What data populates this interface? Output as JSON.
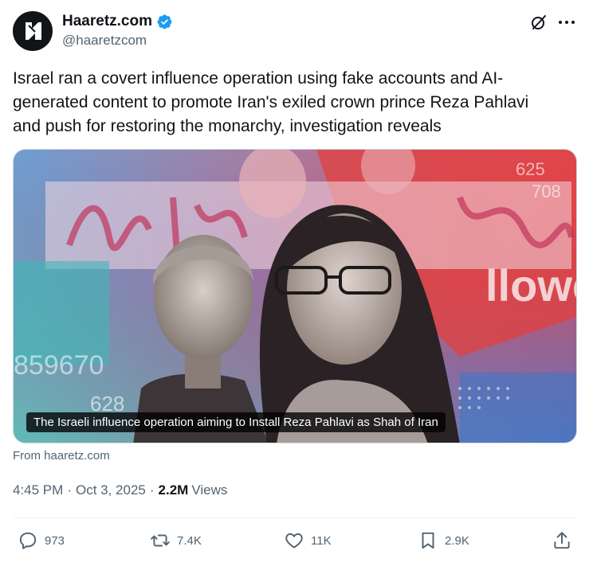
{
  "author": {
    "display_name": "Haaretz.com",
    "handle": "@haaretzcom",
    "verified": true
  },
  "icons": {
    "grok": "grok-icon",
    "more": "more-icon",
    "verified": "verified-badge-icon"
  },
  "tweet": {
    "text_line1": "Israel ran a covert influence operation using fake accounts and AI-",
    "text_line2": "generated content to promote Iran's exiled crown prince Reza Pahlavi",
    "text_line3": "and push for restoring the monarchy, investigation reveals"
  },
  "media": {
    "caption": "The Israeli influence operation aiming to Install Reza Pahlavi as Shah of Iran",
    "overlay_numbers": [
      "859670",
      "628",
      "625",
      "708"
    ],
    "overlay_word": "llowe"
  },
  "link_source": "From haaretz.com",
  "meta": {
    "time": "4:45 PM",
    "date": "Oct 3, 2025",
    "views_count": "2.2M",
    "views_label": "Views"
  },
  "actions": {
    "replies": "973",
    "reposts": "7.4K",
    "likes": "11K",
    "bookmarks": "2.9K"
  },
  "colors": {
    "text_primary": "#0f1419",
    "text_secondary": "#536471",
    "verified_blue": "#1d9bf0",
    "divider": "#eff3f4"
  }
}
